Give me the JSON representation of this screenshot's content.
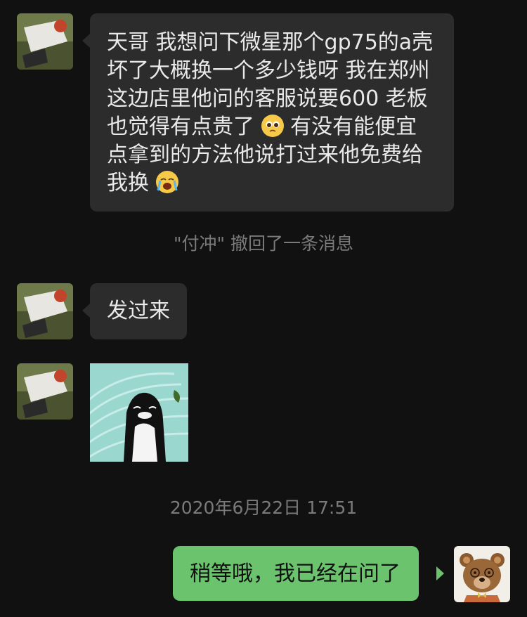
{
  "messages": [
    {
      "sender": "other",
      "text_parts": [
        "天哥 我想问下微星那个gp75的a壳坏了大概换一个多少钱呀 我在郑州这边店里他问的客服说要600 老板也觉得有点贵了",
        "有没有能便宜点拿到的方法他说打过来他免费给我换"
      ],
      "emojis": [
        "pleading-face-emoji",
        "loudly-crying-face-emoji"
      ]
    },
    {
      "sender": "system",
      "text": "\"付冲\" 撤回了一条消息"
    },
    {
      "sender": "other",
      "text": "发过来"
    },
    {
      "sender": "other",
      "type": "sticker",
      "sticker": "penguin-sticker"
    },
    {
      "sender": "system",
      "text": "2020年6月22日 17:51"
    },
    {
      "sender": "me",
      "text": "稍等哦，我已经在问了"
    }
  ],
  "colors": {
    "background": "#111111",
    "incoming_bubble": "#2c2c2c",
    "outgoing_bubble": "#6bc46d",
    "system_text": "#7a7a7a",
    "sticker_bg": "#9ad7cf"
  }
}
